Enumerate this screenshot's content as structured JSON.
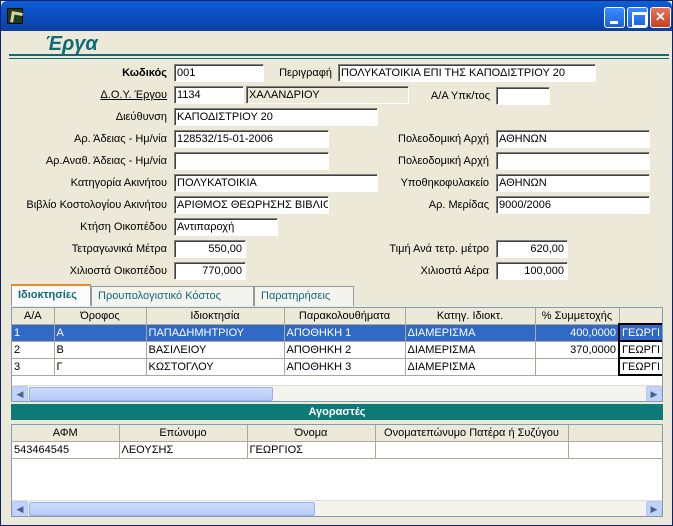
{
  "window": {
    "minimize": "",
    "maximize": "",
    "close": "✕"
  },
  "header": {
    "title": "Έργα"
  },
  "form": {
    "code_label": "Κωδικός",
    "code": "001",
    "desc_label": "Περιγραφή",
    "desc": "ΠΟΛΥΚΑΤΟΙΚΙΑ ΕΠΙ ΤΗΣ ΚΑΠΟΔΙΣΤΡΙΟΥ 20",
    "doy_label": "Δ.Ο.Υ. Έργου",
    "doy_code": "1134",
    "doy_name": "ΧΑΛΑΝΔΡΙΟΥ",
    "aa_label": "Α/Α Υπκ/τος",
    "aa": "",
    "address_label": "Διεύθυνση",
    "address": "ΚΑΠΟΔΙΣΤΡΙΟΥ 20",
    "permit_label": "Αρ. Άδειας - Ημ/νία",
    "permit": "128532/15-01-2006",
    "urban_label": "Πολεοδομική Αρχή",
    "urban": "ΑΘΗΝΩΝ",
    "repermit_label": "Αρ.Αναθ. Άδειας - Ημ/νία",
    "repermit": "",
    "urban2_label": "Πολεοδομική Αρχή",
    "urban2": "",
    "category_label": "Κατηγορία Ακινήτου",
    "category": "ΠΟΛΥΚΑΤΟΙΚΙΑ",
    "mortgage_label": "Υποθηκοφυλακείο",
    "mortgage": "ΑΘΗΝΩΝ",
    "book_label": "Βιβλίο Κοστολογίου Ακινήτου",
    "book": "ΑΡΙΘΜΟΣ ΘΕΩΡΗΣΗΣ ΒΙΒΛΙΟΥ",
    "merid_label": "Αρ. Μερίδας",
    "merid": "9000/2006",
    "land_label": "Κτήση Οικοπέδου",
    "land": "Αντιπαροχή",
    "sqm_label": "Τετραγωνικά Μέτρα",
    "sqm": "550,00",
    "price_label": "Τιμή Ανά τετρ. μέτρο",
    "price": "620,00",
    "plot_label": "Χιλιοστά Οικοπέδου",
    "plot": "770,000",
    "air_label": "Χιλιοστά Αέρα",
    "air": "100,000"
  },
  "tabs": [
    {
      "label": "Ιδιοκτησίες"
    },
    {
      "label": "Προυπολογιστικό Κόστος"
    },
    {
      "label": "Παρατηρήσεις"
    }
  ],
  "owners_table": {
    "headers": [
      "Α/Α",
      "Όροφος",
      "Ιδιοκτησία",
      "Παρακολουθήματα",
      "Κατηγ. Ιδιοκτ.",
      "% Συμμετοχής",
      ""
    ],
    "rows": [
      [
        "1",
        "Α",
        "ΠΑΠΑΔΗΜΗΤΡΙΟΥ",
        "ΑΠΟΘΗΚΗ 1",
        "ΔΙΑΜΕΡΙΣΜΑ",
        "400,0000",
        "ΓΕΩΡΓΙ"
      ],
      [
        "2",
        "Β",
        "ΒΑΣΙΛΕΙΟΥ",
        "ΑΠΟΘΗΚΗ 2",
        "ΔΙΑΜΕΡΙΣΜΑ",
        "370,0000",
        "ΓΕΩΡΓΙ"
      ],
      [
        "3",
        "Γ",
        "ΚΩΣΤΟΓΛΟΥ",
        "ΑΠΟΘΗΚΗ 3",
        "ΔΙΑΜΕΡΙΣΜΑ",
        "",
        "ΓΕΩΡΓΙ"
      ]
    ]
  },
  "buyers": {
    "title": "Αγοραστές",
    "headers": [
      "ΑΦΜ",
      "Επώνυμο",
      "Όνομα",
      "Ονοματεπώνυμο Πατέρα ή  Συζύγου",
      ""
    ],
    "rows": [
      [
        "543464545",
        "ΛΕΟΥΣΗΣ",
        "ΓΕΩΡΓΙΟΣ",
        "",
        ""
      ]
    ]
  },
  "scroll": {
    "left_arrow": "◀",
    "right_arrow": "▶"
  }
}
